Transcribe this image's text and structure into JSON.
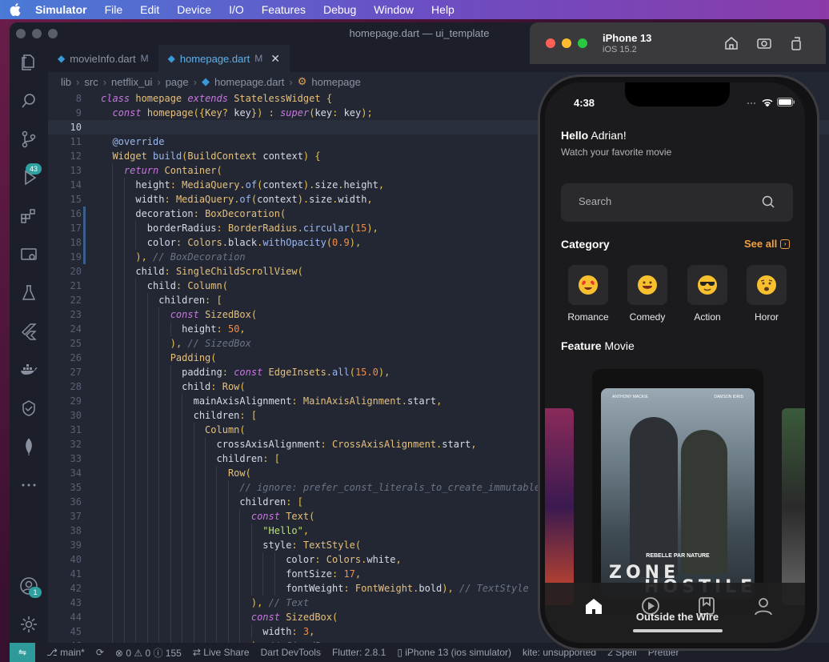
{
  "menubar": {
    "app": "Simulator",
    "items": [
      "File",
      "Edit",
      "Device",
      "I/O",
      "Features",
      "Debug",
      "Window",
      "Help"
    ]
  },
  "window": {
    "title": "homepage.dart — ui_template"
  },
  "activity": {
    "scm_badge": "43",
    "account_badge": "1"
  },
  "tabs": [
    {
      "label": "movieInfo.dart",
      "modified": "M"
    },
    {
      "label": "homepage.dart",
      "modified": "M"
    }
  ],
  "breadcrumb": [
    "lib",
    "src",
    "netflix_ui",
    "page",
    "homepage.dart",
    "homepage"
  ],
  "code_lines": [
    {
      "n": "8",
      "t": "class homepage extends StatelessWidget {"
    },
    {
      "n": "9",
      "t": "  const homepage({Key? key}) : super(key: key);"
    },
    {
      "n": "10",
      "t": ""
    },
    {
      "n": "11",
      "t": "  @override"
    },
    {
      "n": "12",
      "t": "  Widget build(BuildContext context) {"
    },
    {
      "n": "13",
      "t": "    return Container("
    },
    {
      "n": "14",
      "t": "      height: MediaQuery.of(context).size.height,"
    },
    {
      "n": "15",
      "t": "      width: MediaQuery.of(context).size.width,"
    },
    {
      "n": "16",
      "t": "      decoration: BoxDecoration("
    },
    {
      "n": "17",
      "t": "        borderRadius: BorderRadius.circular(15),"
    },
    {
      "n": "18",
      "t": "        color: Colors.black.withOpacity(0.9),"
    },
    {
      "n": "19",
      "t": "      ), // BoxDecoration"
    },
    {
      "n": "20",
      "t": "      child: SingleChildScrollView("
    },
    {
      "n": "21",
      "t": "        child: Column("
    },
    {
      "n": "22",
      "t": "          children: ["
    },
    {
      "n": "23",
      "t": "            const SizedBox("
    },
    {
      "n": "24",
      "t": "              height: 50,"
    },
    {
      "n": "25",
      "t": "            ), // SizedBox"
    },
    {
      "n": "26",
      "t": "            Padding("
    },
    {
      "n": "27",
      "t": "              padding: const EdgeInsets.all(15.0),"
    },
    {
      "n": "28",
      "t": "              child: Row("
    },
    {
      "n": "29",
      "t": "                mainAxisAlignment: MainAxisAlignment.start,"
    },
    {
      "n": "30",
      "t": "                children: ["
    },
    {
      "n": "31",
      "t": "                  Column("
    },
    {
      "n": "32",
      "t": "                    crossAxisAlignment: CrossAxisAlignment.start,"
    },
    {
      "n": "33",
      "t": "                    children: ["
    },
    {
      "n": "34",
      "t": "                      Row("
    },
    {
      "n": "35",
      "t": "                        // ignore: prefer_const_literals_to_create_immutables"
    },
    {
      "n": "36",
      "t": "                        children: ["
    },
    {
      "n": "37",
      "t": "                          const Text("
    },
    {
      "n": "38",
      "t": "                            \"Hello\","
    },
    {
      "n": "39",
      "t": "                            style: TextStyle("
    },
    {
      "n": "40",
      "t": "                                color: Colors.white,"
    },
    {
      "n": "41",
      "t": "                                fontSize: 17,"
    },
    {
      "n": "42",
      "t": "                                fontWeight: FontWeight.bold), // TextStyle"
    },
    {
      "n": "43",
      "t": "                          ), // Text"
    },
    {
      "n": "44",
      "t": "                          const SizedBox("
    },
    {
      "n": "45",
      "t": "                            width: 3,"
    },
    {
      "n": "46",
      "t": "                          ), // SizedBox"
    }
  ],
  "statusbar": {
    "branch": "main*",
    "errors": "0",
    "warnings": "0",
    "info": "155",
    "live_share": "Live Share",
    "devtools": "Dart DevTools",
    "flutter": "Flutter: 2.8.1",
    "device": "iPhone 13 (ios simulator)",
    "kite": "kite: unsupported",
    "spell": "2 Spell",
    "prettier": "Prettier"
  },
  "simulator": {
    "device": "iPhone 13",
    "os": "iOS 15.2"
  },
  "app": {
    "time": "4:38",
    "hello": "Hello",
    "name": "Adrian!",
    "subtitle": "Watch your favorite movie",
    "search_placeholder": "Search",
    "category_title": "Category",
    "see_all": "See all",
    "categories": [
      {
        "label": "Romance",
        "icon": "heart-eyes-emoji-icon"
      },
      {
        "label": "Comedy",
        "icon": "laughing-emoji-icon"
      },
      {
        "label": "Action",
        "icon": "sunglasses-emoji-icon"
      },
      {
        "label": "Horor",
        "icon": "fearful-emoji-icon"
      }
    ],
    "feature_bold": "Feature",
    "feature_rest": "Movie",
    "poster": {
      "actor_left": "ANTHONY MACKIE",
      "actor_right": "DAMSON IDRIS",
      "tagline": "REBELLE PAR NATURE",
      "title_line1": "ZONE",
      "title_line2": "HOSTILE"
    },
    "movie_title": "Outside the Wire"
  }
}
